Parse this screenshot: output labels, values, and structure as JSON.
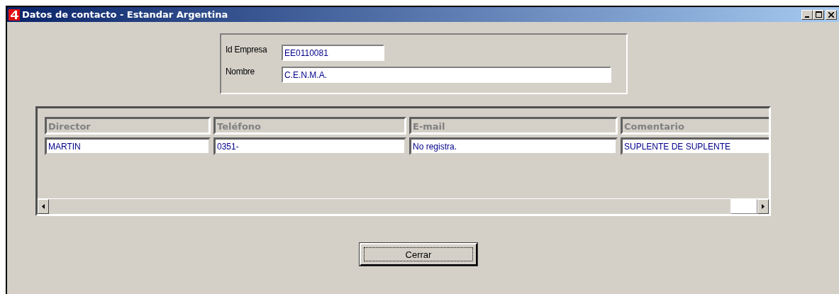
{
  "window": {
    "title": "Datos de contacto - Estandar Argentina"
  },
  "company": {
    "id_label": "Id Empresa",
    "id_value": "EE0110081",
    "name_label": "Nombre",
    "name_value": "C.E.N.M.A."
  },
  "table": {
    "columns": [
      "Director",
      "Teléfono",
      "E-mail",
      "Comentario"
    ],
    "rows": [
      [
        "MARTIN",
        "0351-",
        "No registra.",
        "SUPLENTE DE SUPLENTE"
      ]
    ]
  },
  "buttons": [
    {
      "label": "Cerrar"
    }
  ]
}
